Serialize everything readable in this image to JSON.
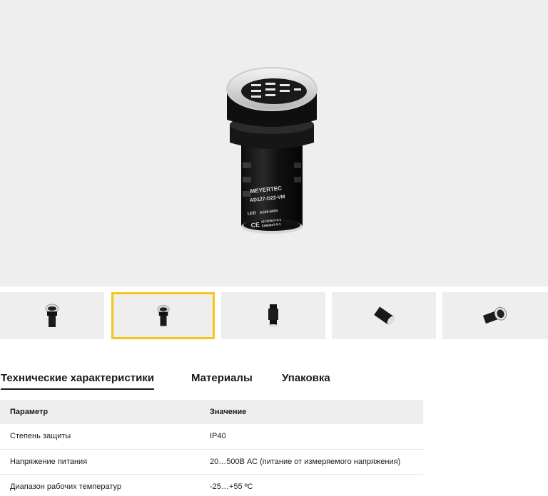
{
  "product": {
    "brand_text": "MEYERTEC",
    "model_text": "AD127-D22-VM",
    "led_text": "LED",
    "voltage_text": "AC20-500V",
    "cert_text_1": "IEC60947-5-1",
    "cert_text_2": "EN60947-5-1",
    "ce_mark": "CE"
  },
  "gallery": {
    "active_index": 1,
    "thumb_count": 5,
    "highlight_color": "#f5c518"
  },
  "tabs": [
    {
      "label": "Технические характеристики",
      "active": true
    },
    {
      "label": "Материалы",
      "active": false
    },
    {
      "label": "Упаковка",
      "active": false
    }
  ],
  "specs": {
    "header": {
      "param": "Параметр",
      "value": "Значение"
    },
    "rows": [
      {
        "param": "Степень защиты",
        "value": "IP40"
      },
      {
        "param": "Напряжение питания",
        "value": "20…500В АС (питание от измеряемого напряжения)"
      },
      {
        "param": "Диапазон рабочих температур",
        "value": "-25…+55 ºC"
      }
    ]
  }
}
